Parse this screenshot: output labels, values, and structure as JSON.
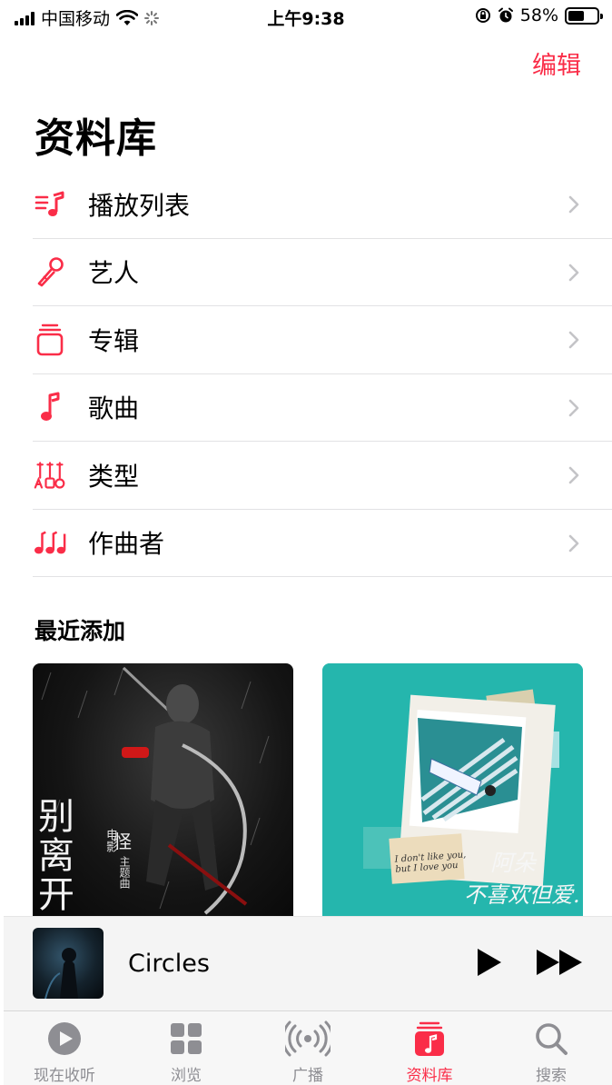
{
  "status_bar": {
    "carrier": "中国移动",
    "time": "上午9:38",
    "battery_percent": "58%",
    "battery_level": 0.58
  },
  "header": {
    "edit_label": "编辑",
    "title": "资料库"
  },
  "menu": {
    "items": [
      {
        "label": "播放列表",
        "icon": "playlist-icon"
      },
      {
        "label": "艺人",
        "icon": "microphone-icon"
      },
      {
        "label": "专辑",
        "icon": "album-stack-icon"
      },
      {
        "label": "歌曲",
        "icon": "music-note-icon"
      },
      {
        "label": "类型",
        "icon": "genre-icon"
      },
      {
        "label": "作曲者",
        "icon": "composer-icon"
      }
    ]
  },
  "recent": {
    "title": "最近添加",
    "albums": [
      {
        "cover_text": "别离开",
        "cover_sub": "电影",
        "cover_sub2": "主题曲",
        "cover_logo": "怪"
      },
      {
        "cover_artist": "阿朵",
        "cover_title": "不喜欢但爱.",
        "cover_lyrics": "I don't like you, but I love you"
      }
    ]
  },
  "mini_player": {
    "title": "Circles"
  },
  "tab_bar": {
    "tabs": [
      {
        "label": "现在收听",
        "icon": "play-circle-icon"
      },
      {
        "label": "浏览",
        "icon": "grid-icon"
      },
      {
        "label": "广播",
        "icon": "radio-icon"
      },
      {
        "label": "资料库",
        "icon": "library-icon",
        "active": true
      },
      {
        "label": "搜索",
        "icon": "search-icon"
      }
    ]
  },
  "colors": {
    "accent": "#fa2d48",
    "inactive": "#8e8e93"
  }
}
